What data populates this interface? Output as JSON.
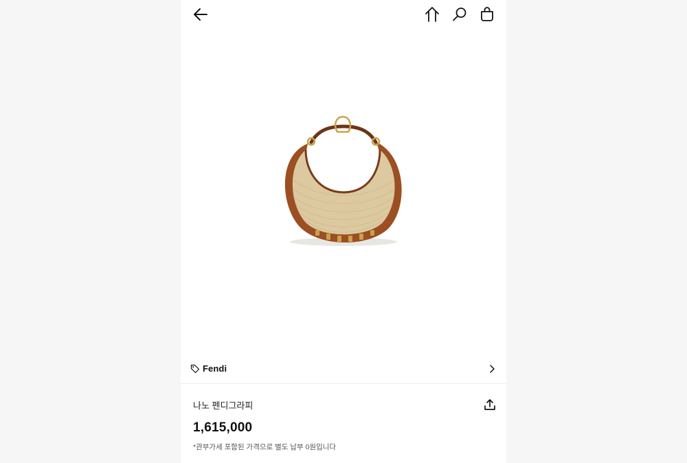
{
  "header": {
    "icons": [
      "arrow-left-icon",
      "home-icon",
      "search-icon",
      "shopping-bag-icon"
    ]
  },
  "product": {
    "image_alt": "Fendi nano Fendigraphy straw hobo bag",
    "brand": "Fendi",
    "name": "나노 펜디그라피",
    "price": "1,615,000",
    "tax_note": "*관부가세 포함된 가격으로 별도 납부 0원입니다"
  },
  "colors": {
    "page_background": "#f6f6f6",
    "panel_background": "#ffffff",
    "text_primary": "#111111",
    "straw": "#dcc9a0",
    "leather": "#9b4f22",
    "gold": "#c9a24a"
  }
}
